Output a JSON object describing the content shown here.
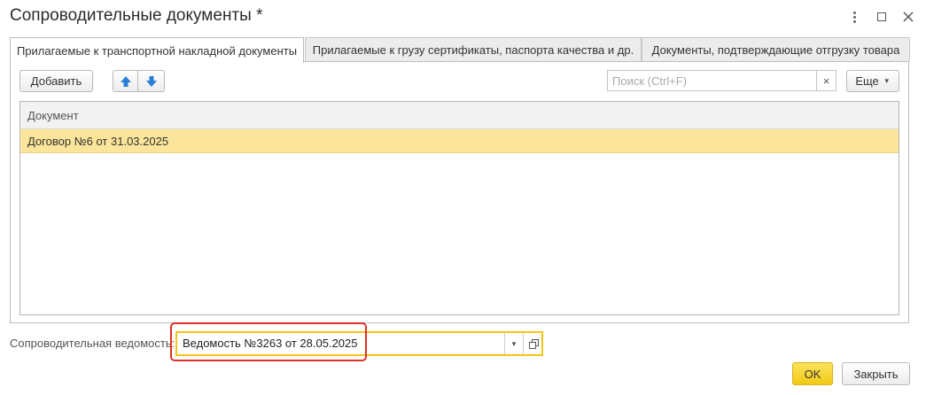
{
  "window": {
    "title": "Сопроводительные документы *",
    "icons": [
      "menu-dots-icon",
      "maximize-icon",
      "close-icon"
    ]
  },
  "tabs": [
    {
      "label": "Прилагаемые к транспортной накладной документы",
      "active": true
    },
    {
      "label": "Прилагаемые к грузу сертификаты, паспорта качества и др.",
      "active": false
    },
    {
      "label": "Документы, подтверждающие отгрузку товара",
      "active": false
    }
  ],
  "toolbar": {
    "add_label": "Добавить",
    "search_placeholder": "Поиск (Ctrl+F)",
    "search_clear": "×",
    "more_label": "Еще"
  },
  "table": {
    "columns": [
      "Документ"
    ],
    "rows": [
      [
        "Договор №6 от 31.03.2025"
      ]
    ]
  },
  "bottom_field": {
    "label": "Сопроводительная ведомость:",
    "value": "Ведомость №3263 от 28.05.2025"
  },
  "footer": {
    "ok_label": "OK",
    "close_label": "Закрыть"
  },
  "colors": {
    "selected_row": "#fbe59a",
    "field_border": "#f5c518",
    "ok_button": "#f1c915",
    "arrow_blue": "#2a7fd4",
    "highlight_frame": "#e0302a"
  }
}
